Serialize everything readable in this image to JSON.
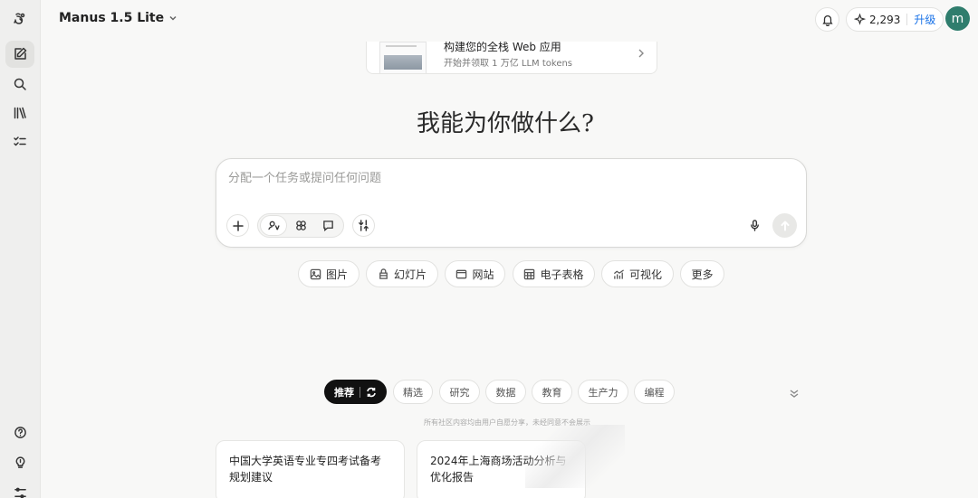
{
  "app": {
    "title": "Manus 1.5 Lite"
  },
  "header": {
    "credits": "2,293",
    "upgrade_label": "升级",
    "avatar_letter": "m"
  },
  "promo": {
    "title": "构建您的全栈 Web 应用",
    "subtitle": "开始并领取 1 万亿 LLM tokens"
  },
  "hero": {
    "title": "我能为你做什么?"
  },
  "composer": {
    "placeholder": "分配一个任务或提问任何问题"
  },
  "quick_actions": [
    {
      "label": "图片",
      "icon": "image-icon"
    },
    {
      "label": "幻灯片",
      "icon": "slides-icon"
    },
    {
      "label": "网站",
      "icon": "website-icon"
    },
    {
      "label": "电子表格",
      "icon": "table-icon"
    },
    {
      "label": "可视化",
      "icon": "chart-icon"
    },
    {
      "label": "更多",
      "icon": ""
    }
  ],
  "filters": {
    "active": "推荐",
    "items": [
      "精选",
      "研究",
      "数据",
      "教育",
      "生产力",
      "编程"
    ]
  },
  "notice": "所有社区内容均由用户自愿分享，未经同意不会展示",
  "cards": [
    {
      "title": "中国大学英语专业专四考试备考规划建议"
    },
    {
      "title": "2024年上海商场活动分析与优化报告"
    }
  ]
}
